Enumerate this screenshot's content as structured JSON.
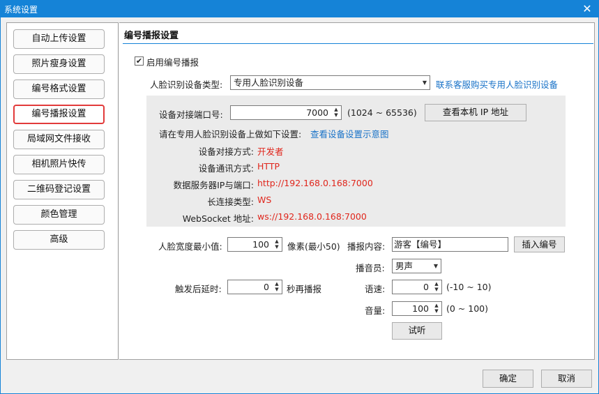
{
  "window": {
    "title": "系统设置",
    "close_glyph": "✕"
  },
  "sidebar": {
    "items": [
      {
        "label": "自动上传设置"
      },
      {
        "label": "照片瘦身设置"
      },
      {
        "label": "编号格式设置"
      },
      {
        "label": "编号播报设置",
        "active": true
      },
      {
        "label": "局域网文件接收"
      },
      {
        "label": "相机照片快传"
      },
      {
        "label": "二维码登记设置"
      },
      {
        "label": "颜色管理"
      },
      {
        "label": "高级"
      }
    ]
  },
  "main": {
    "title": "编号播报设置",
    "enable_checkbox": {
      "label": "启用编号播报",
      "checked": true,
      "mark": "✔"
    },
    "device_type": {
      "label": "人脸识别设备类型:",
      "value": "专用人脸识别设备",
      "link": "联系客服购买专用人脸识别设备"
    },
    "port": {
      "label": "设备对接端口号:",
      "value": "7000",
      "range": "(1024 ~ 65536)",
      "button": "查看本机 IP 地址"
    },
    "instructions": {
      "text": "请在专用人脸识别设备上做如下设置:",
      "link": "查看设备设置示意图"
    },
    "settings": [
      {
        "label": "设备对接方式:",
        "value": "开发者"
      },
      {
        "label": "设备通讯方式:",
        "value": "HTTP"
      },
      {
        "label": "数据服务器IP与端口:",
        "value": "http://192.168.0.168:7000"
      },
      {
        "label": "长连接类型:",
        "value": "WS"
      },
      {
        "label": "WebSocket 地址:",
        "value": "ws://192.168.0.168:7000"
      }
    ],
    "face_width": {
      "label": "人脸宽度最小值:",
      "value": "100",
      "unit": "像素(最小50)"
    },
    "trigger_delay": {
      "label": "触发后延时:",
      "value": "0",
      "unit": "秒再播报"
    },
    "broadcast": {
      "content_label": "播报内容:",
      "content_value": "游客【编号】",
      "insert_button": "插入编号",
      "speaker_label": "播音员:",
      "speaker_value": "男声",
      "speed_label": "语速:",
      "speed_value": "0",
      "speed_range": "(-10 ~ 10)",
      "volume_label": "音量:",
      "volume_value": "100",
      "volume_range": "(0 ~ 100)",
      "test_button": "试听"
    }
  },
  "footer": {
    "ok": "确定",
    "cancel": "取消"
  },
  "colors": {
    "titlebar": "#1583d7",
    "link": "#1a73c8",
    "value_red": "#e0261c",
    "active_border": "#e23a3a"
  }
}
